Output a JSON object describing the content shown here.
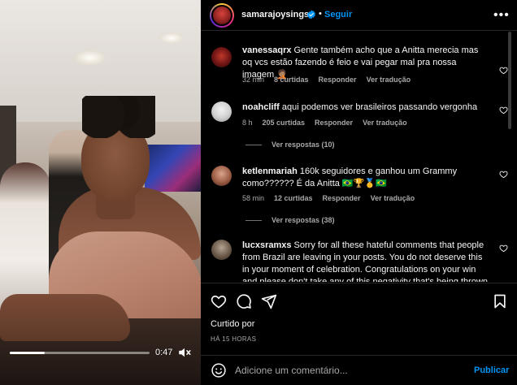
{
  "video": {
    "time": "0:47",
    "progress": 0.25
  },
  "header": {
    "username": "samarajoysings",
    "separator": "•",
    "follow_label": "Seguir",
    "more_label": "•••"
  },
  "comments": [
    {
      "user": "vanessaqrx",
      "text": "Gente também acho que a Anitta merecia mas oq vcs estão fazendo é feio e vai pegar mal pra nossa imagem 🤦🏽",
      "time": "32 min",
      "likes": "8 curtidas",
      "reply": "Responder",
      "translate": "Ver tradução"
    },
    {
      "user": "noahcliff",
      "text": "aqui podemos ver brasileiros passando vergonha",
      "time": "8 h",
      "likes": "205 curtidas",
      "reply": "Responder",
      "translate": "Ver tradução",
      "view_replies": "Ver respostas (10)"
    },
    {
      "user": "ketlenmariah",
      "text": "160k seguidores e ganhou um Grammy como?????? É da Anitta 🇧🇷🏆🥇🇧🇷",
      "time": "58 min",
      "likes": "12 curtidas",
      "reply": "Responder",
      "translate": "Ver tradução",
      "view_replies": "Ver respostas (38)"
    },
    {
      "user": "lucxsramxs",
      "text": "Sorry for all these hateful comments that people from Brazil are leaving in your posts. You do not deserve this in your moment of celebration. Congratulations on your win and please don't take any of this negativity that's being thrown at"
    }
  ],
  "actions": {
    "liked_label": "Curtido por",
    "posted_ago": "HÁ 15 HORAS"
  },
  "add_comment": {
    "placeholder": "Adicione um comentário...",
    "publish_label": "Publicar"
  },
  "colors": {
    "accent": "#0095f6",
    "background": "#000000",
    "muted_text": "#a8a8a8"
  }
}
